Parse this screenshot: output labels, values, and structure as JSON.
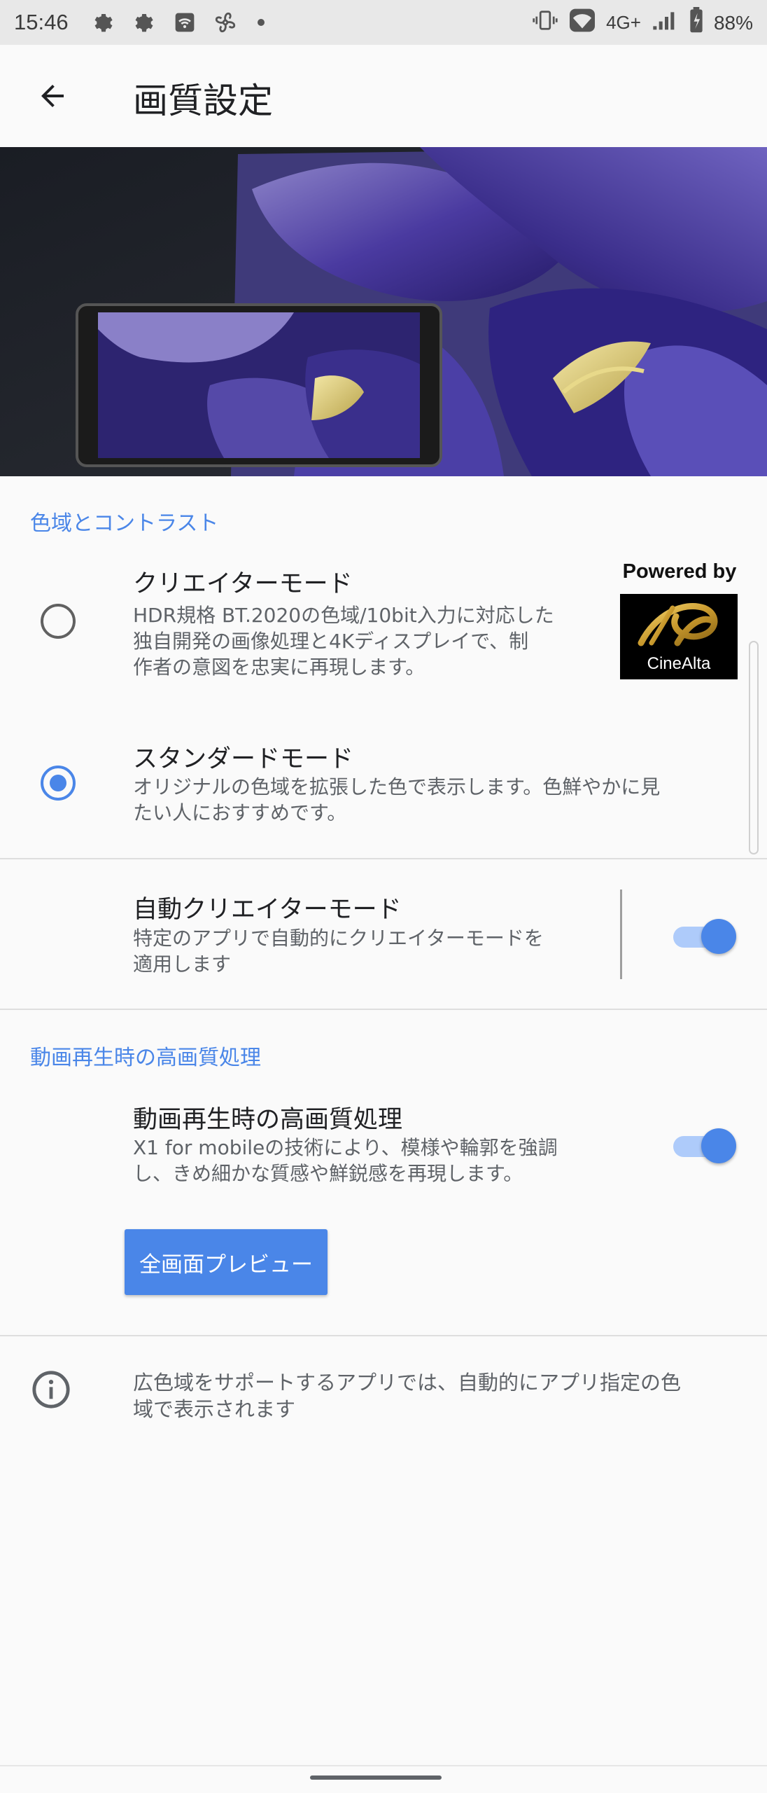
{
  "status_bar": {
    "time": "15:46",
    "network": "4G+",
    "battery": "88%"
  },
  "app_bar": {
    "title": "画質設定"
  },
  "color_section": {
    "header": "色域とコントラスト",
    "creator_mode": {
      "title": "クリエイターモード",
      "description_lines": [
        "HDR規格  BT.2020の色域/10bit入力に対応した",
        "独自開発の画像処理と4Kディスプレイで、制",
        "作者の意図を忠実に再現します。"
      ],
      "selected": false
    },
    "logo": {
      "powered_by": "Powered by",
      "brand": "CineAlta"
    },
    "standard_mode": {
      "title": "スタンダードモード",
      "description_lines": [
        "オリジナルの色域を拡張した色で表示します。色鮮やかに見",
        "たい人におすすめです。"
      ],
      "selected": true
    },
    "auto_creator": {
      "title": "自動クリエイターモード",
      "description_lines": [
        "特定のアプリで自動的にクリエイターモードを",
        "適用します"
      ],
      "enabled": true
    }
  },
  "video_section": {
    "header": "動画再生時の高画質処理",
    "video_enhance": {
      "title": "動画再生時の高画質処理",
      "description_lines": [
        "X1 for mobileの技術により、模様や輪郭を強調",
        "し、きめ細かな質感や鮮鋭感を再現します。"
      ],
      "enabled": true
    },
    "preview_button": "全画面プレビュー"
  },
  "info": {
    "text_lines": [
      "広色域をサポートするアプリでは、自動的にアプリ指定の色",
      "域で表示されます"
    ]
  },
  "colors": {
    "accent": "#4a86e8",
    "hero_purple": "#3a2d8a"
  }
}
